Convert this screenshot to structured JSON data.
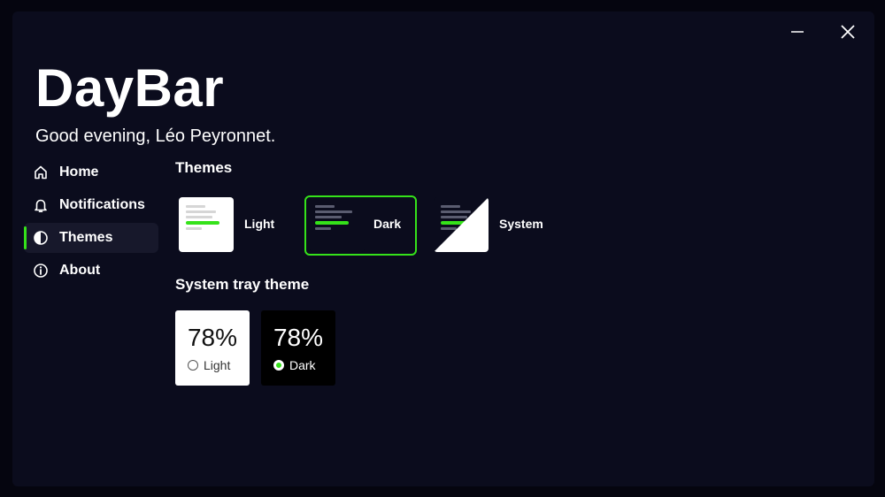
{
  "window": {
    "minimize_icon": "minimize-icon",
    "close_icon": "close-icon"
  },
  "header": {
    "app_title": "DayBar",
    "greeting": "Good evening, Léo Peyronnet."
  },
  "sidebar": {
    "items": [
      {
        "label": "Home",
        "icon": "home-icon",
        "active": false
      },
      {
        "label": "Notifications",
        "icon": "bell-icon",
        "active": false
      },
      {
        "label": "Themes",
        "icon": "half-circle-icon",
        "active": true
      },
      {
        "label": "About",
        "icon": "info-icon",
        "active": false
      }
    ]
  },
  "themes": {
    "title": "Themes",
    "options": [
      {
        "label": "Light",
        "selected": false
      },
      {
        "label": "Dark",
        "selected": true
      },
      {
        "label": "System",
        "selected": false
      }
    ]
  },
  "tray": {
    "title": "System tray theme",
    "options": [
      {
        "percent": "78%",
        "label": "Light",
        "selected": false
      },
      {
        "percent": "78%",
        "label": "Dark",
        "selected": true
      }
    ]
  },
  "colors": {
    "accent": "#35e21a",
    "background": "#0b0c1d",
    "outer": "#05050f"
  }
}
